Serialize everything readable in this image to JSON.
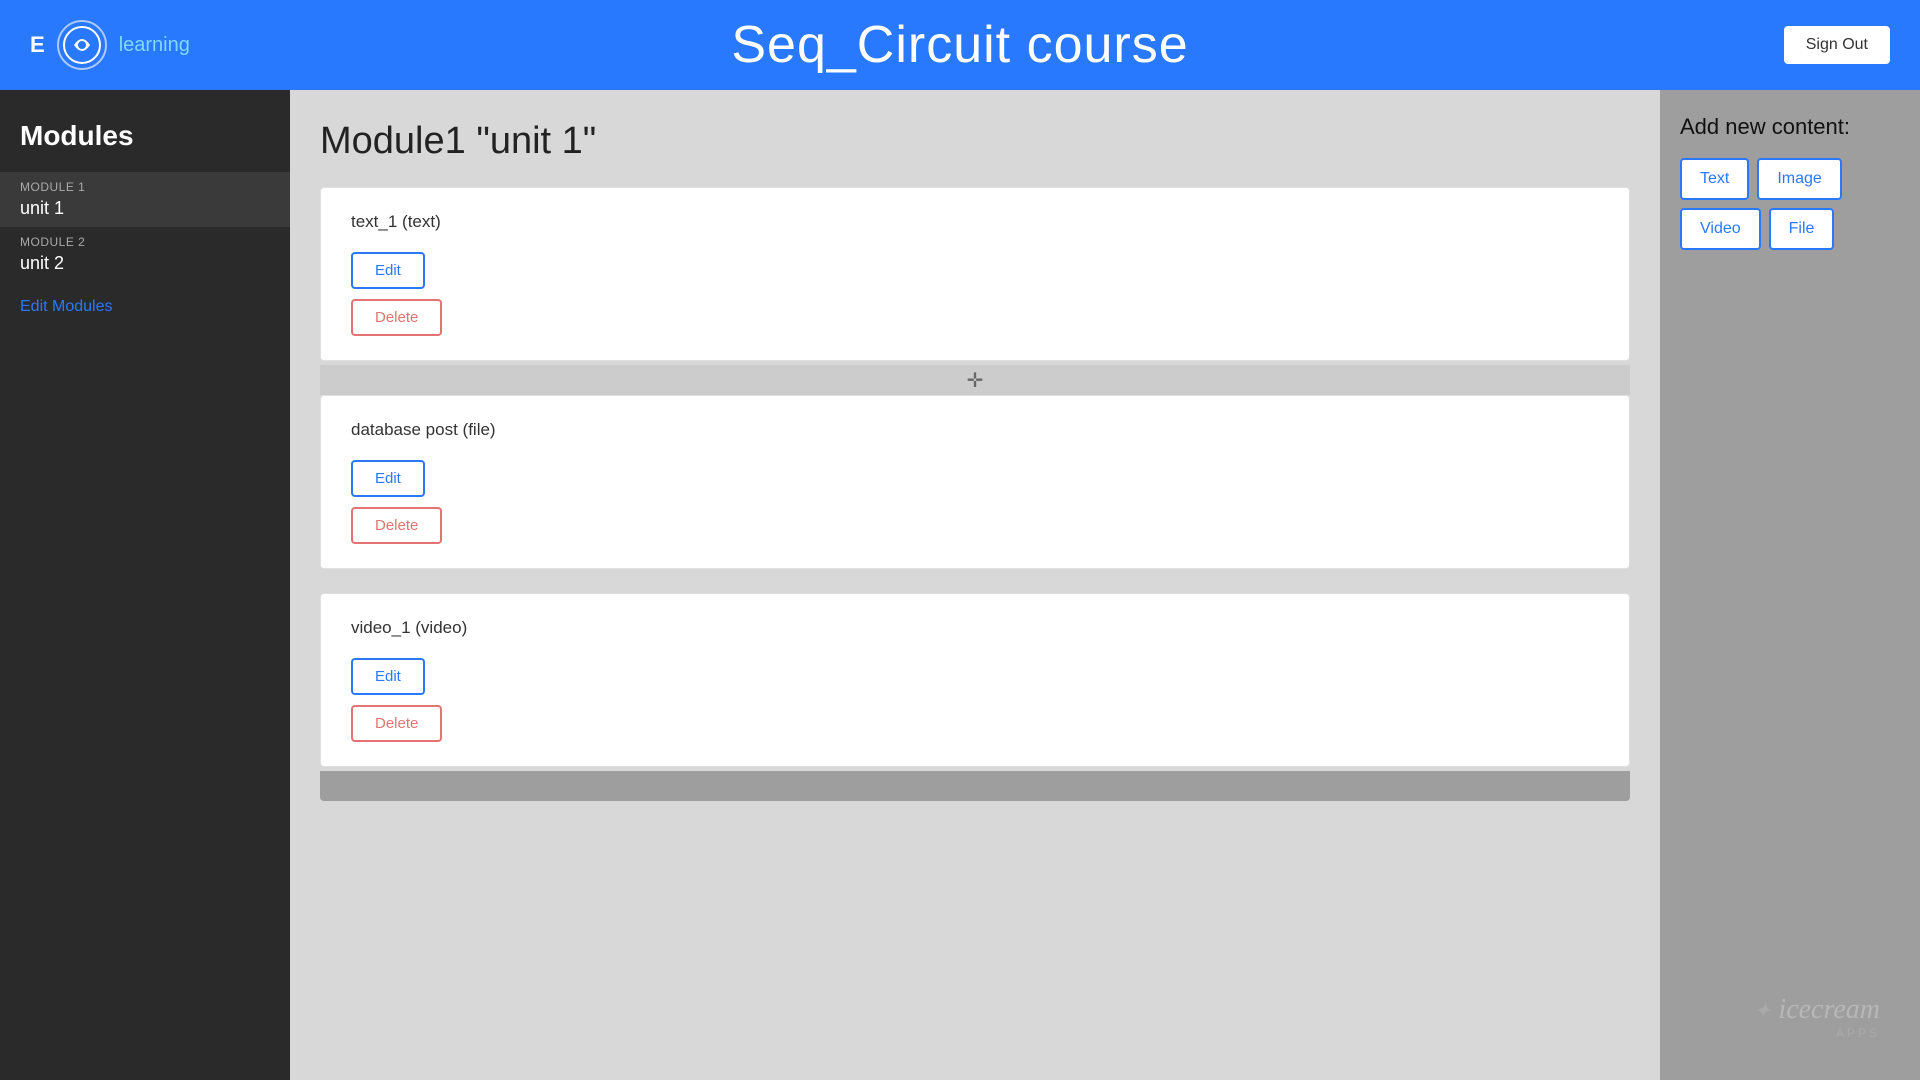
{
  "header": {
    "e_label": "E",
    "learning_label": "learning",
    "title": "Seq_Circuit course",
    "signout_label": "Sign Out"
  },
  "sidebar": {
    "title": "Modules",
    "modules": [
      {
        "label": "MODULE 1",
        "name": "unit 1",
        "active": true
      },
      {
        "label": "MODULE 2",
        "name": "unit 2",
        "active": false
      }
    ],
    "edit_modules_label": "Edit Modules"
  },
  "page": {
    "title": "Module1 \"unit 1\""
  },
  "content_blocks": [
    {
      "id": "block1",
      "title": "text_1 (text)",
      "edit_label": "Edit",
      "delete_label": "Delete"
    },
    {
      "id": "block2",
      "title": "database post (file)",
      "edit_label": "Edit",
      "delete_label": "Delete"
    },
    {
      "id": "block3",
      "title": "video_1 (video)",
      "edit_label": "Edit",
      "delete_label": "Delete"
    }
  ],
  "add_content": {
    "title": "Add new content:",
    "buttons": [
      {
        "label": "Text",
        "id": "text"
      },
      {
        "label": "Image",
        "id": "image"
      },
      {
        "label": "Video",
        "id": "video"
      },
      {
        "label": "File",
        "id": "file"
      }
    ]
  },
  "watermark": {
    "text": "icecream",
    "subtext": "APPS"
  }
}
